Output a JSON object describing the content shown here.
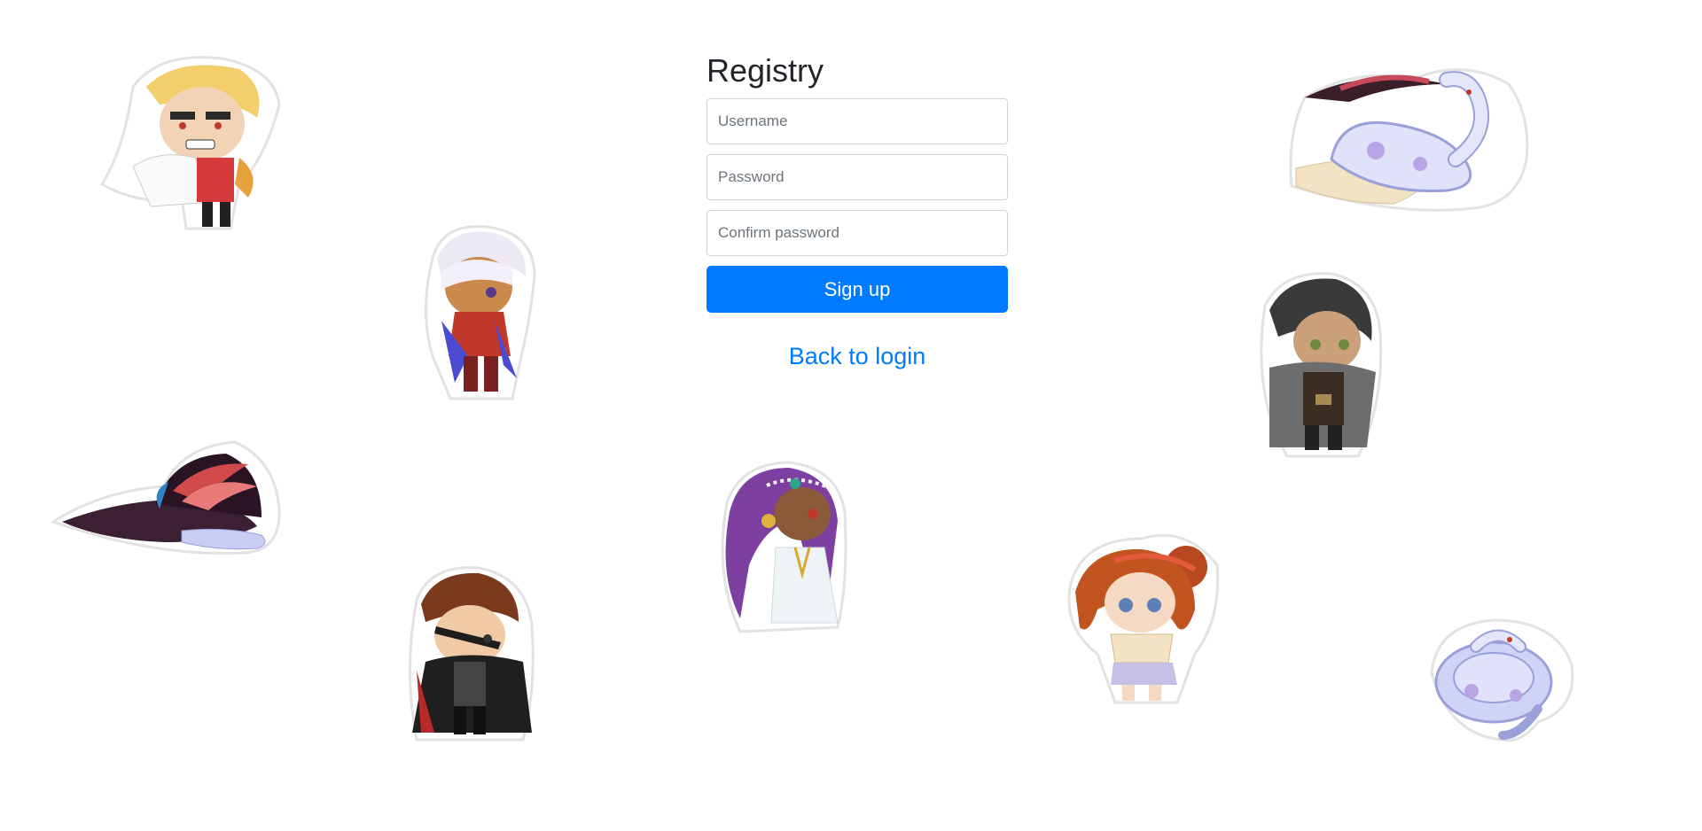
{
  "form": {
    "title": "Registry",
    "username_placeholder": "Username",
    "password_placeholder": "Password",
    "confirm_placeholder": "Confirm password",
    "signup_label": "Sign up",
    "back_label": "Back to login"
  },
  "colors": {
    "primary": "#007bff",
    "title": "#212529",
    "input_border": "#ced4da"
  },
  "stickers": [
    "chibi-blond-noble-sticker",
    "chibi-white-hair-warrior-sticker",
    "wizard-hat-snake-sticker",
    "chibi-eyepatch-pirate-sticker",
    "chibi-purple-hair-sorceress-sticker",
    "snake-on-scroll-sticker",
    "chibi-dark-hair-rogue-sticker",
    "chibi-redhead-girl-sticker",
    "coiled-snake-sticker"
  ]
}
